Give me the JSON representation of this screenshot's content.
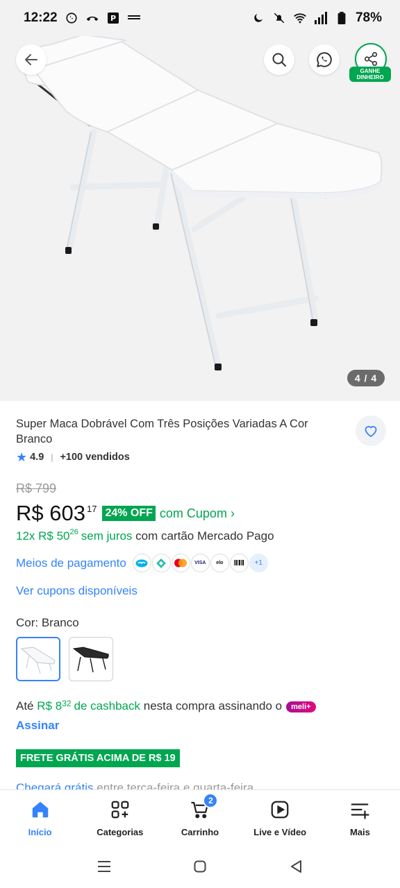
{
  "status_bar": {
    "time": "12:22",
    "battery": "78%",
    "left_icons": [
      "whatsapp-icon",
      "call-icon",
      "parking-app-icon",
      "news-app-icon"
    ],
    "right_icons": [
      "do-not-disturb-icon",
      "mute-icon",
      "wifi-icon",
      "signal-icon",
      "battery-icon"
    ]
  },
  "gallery": {
    "counter": "4 / 4",
    "share_badge": "GANHE DINHEIRO"
  },
  "product": {
    "title": "Super Maca Dobrável Com Três Posições Variadas A Cor Branco",
    "rating": "4.9",
    "sold": "+100 vendidos"
  },
  "price": {
    "old": "R$ 799",
    "current": "R$ 603",
    "cents": "17",
    "discount": "24% OFF",
    "coupon": "com Cupom ›"
  },
  "installments": {
    "count": "12x R$ 50",
    "cents": "26",
    "interest": "sem juros",
    "card": "com cartão Mercado Pago"
  },
  "payment": {
    "link": "Meios de pagamento",
    "methods": [
      "mercado-pago-icon",
      "pix-icon",
      "mastercard-icon",
      "visa-icon",
      "elo-icon",
      "boleto-icon"
    ],
    "more": "+1"
  },
  "cupons_link": "Ver cupons disponíveis",
  "color": {
    "label": "Cor: Branco",
    "options": [
      "white-bed-swatch",
      "black-bed-swatch"
    ],
    "selected": 0
  },
  "cashback": {
    "prefix": "Até",
    "amount": "R$ 8",
    "cents": "32",
    "label": "de cashback",
    "suffix": "nesta compra assinando o",
    "badge": "meli+",
    "cta": "Assinar"
  },
  "shipping_badge": "FRETE GRÁTIS ACIMA DE R$ 19",
  "peek_text": {
    "blue": "Chegará grátis",
    "rest": " entre terça-feira e quarta-feira"
  },
  "bottom_nav": {
    "items": [
      {
        "label": "Início",
        "icon": "home-icon",
        "active": true
      },
      {
        "label": "Categorias",
        "icon": "categories-icon",
        "active": false
      },
      {
        "label": "Carrinho",
        "icon": "cart-icon",
        "active": false,
        "badge": "2"
      },
      {
        "label": "Live e Vídeo",
        "icon": "video-icon",
        "active": false
      },
      {
        "label": "Mais",
        "icon": "more-icon",
        "active": false
      }
    ]
  },
  "colors": {
    "brand_blue": "#3483fa",
    "brand_green": "#00a650",
    "meli_pink": "#e4087d"
  }
}
